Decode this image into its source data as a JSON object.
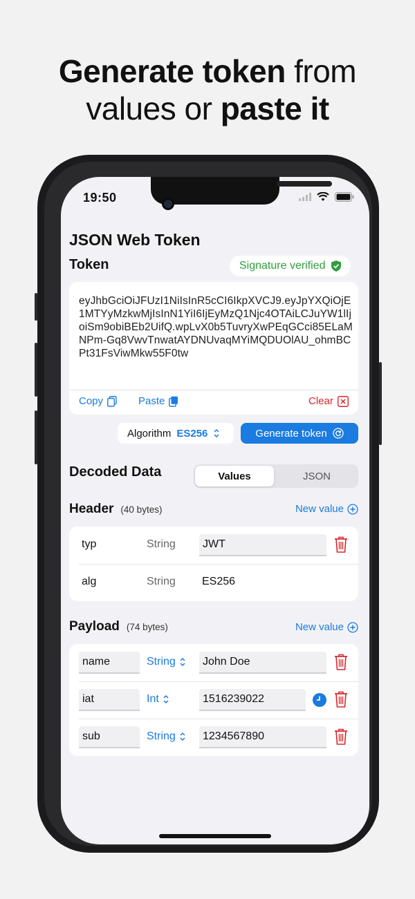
{
  "headline": {
    "line1_bold": "Generate token",
    "line1_light": " from",
    "line2_light": "values or ",
    "line2_bold": "paste it"
  },
  "status_bar": {
    "time": "19:50"
  },
  "app": {
    "title": "JSON Web Token"
  },
  "token": {
    "label": "Token",
    "signature_status": "Signature verified",
    "value": "eyJhbGciOiJFUzI1NiIsInR5cCI6IkpXVCJ9.eyJpYXQiOjE1MTYyMzkwMjIsInN1YiI6IjEyMzQ1Njc4OTAiLCJuYW1lIjoiSm9obiBEb2UifQ.wpLvX0b5TuvryXwPEqGCci85ELaMNPm-Gq8VwvTnwatAYDNUvaqMYiMQDUOlAU_ohmBCPt31FsViwMkw55F0tw",
    "copy_label": "Copy",
    "paste_label": "Paste",
    "clear_label": "Clear"
  },
  "algorithm": {
    "label": "Algorithm",
    "value": "ES256"
  },
  "generate_button": "Generate token",
  "decoded": {
    "label": "Decoded Data",
    "tabs": [
      {
        "label": "Values",
        "selected": true
      },
      {
        "label": "JSON",
        "selected": false
      }
    ]
  },
  "header_section": {
    "name": "Header",
    "bytes": "(40 bytes)",
    "new_value": "New value",
    "rows": [
      {
        "key": "typ",
        "type": "String",
        "value": "JWT"
      },
      {
        "key": "alg",
        "type": "String",
        "value": "ES256"
      }
    ]
  },
  "payload_section": {
    "name": "Payload",
    "bytes": "(74 bytes)",
    "new_value": "New value",
    "rows": [
      {
        "key": "name",
        "type": "String",
        "value": "John Doe"
      },
      {
        "key": "iat",
        "type": "Int",
        "value": "1516239022"
      },
      {
        "key": "sub",
        "type": "String",
        "value": "1234567890"
      }
    ]
  },
  "colors": {
    "accent": "#1a7be0",
    "success": "#2e9e3e",
    "danger": "#d9262b"
  },
  "icons": [
    "verified-shield-icon",
    "copy-icon",
    "paste-icon",
    "clear-x-icon",
    "chevron-updown-icon",
    "refresh-icon",
    "plus-circle-icon",
    "trash-icon",
    "clock-icon",
    "wifi-icon",
    "signal-icon",
    "battery-icon"
  ]
}
